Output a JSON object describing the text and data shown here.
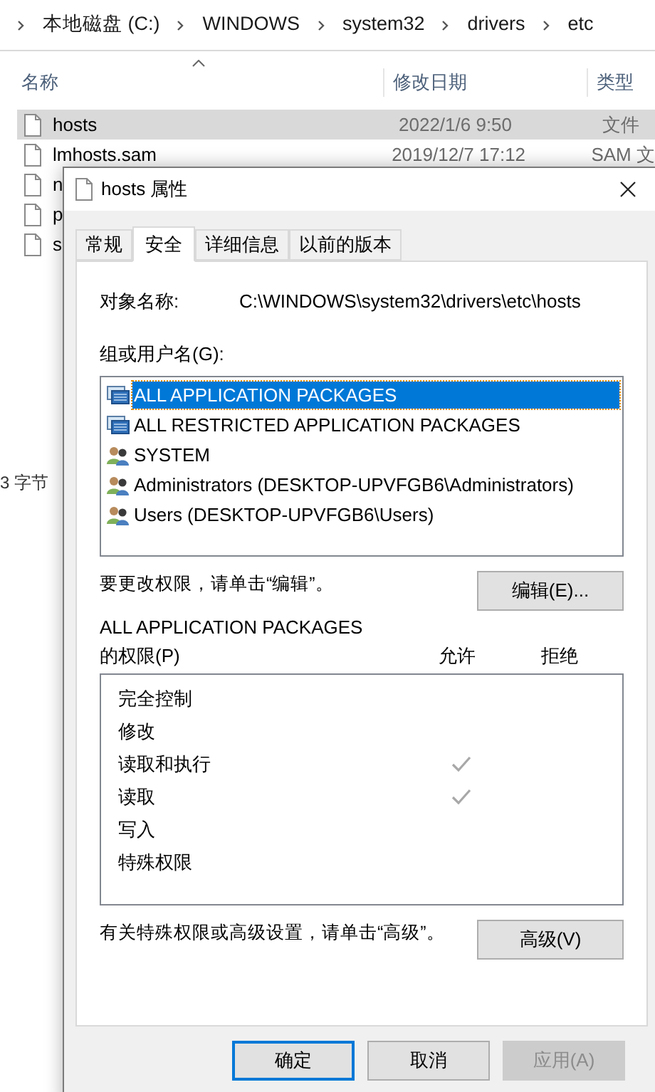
{
  "explorer": {
    "breadcrumb": [
      "本地磁盘 (C:)",
      "WINDOWS",
      "system32",
      "drivers",
      "etc"
    ],
    "columns": [
      "名称",
      "修改日期",
      "类型"
    ],
    "rows": [
      {
        "name": "hosts",
        "date": "2022/1/6 9:50",
        "type": "文件",
        "selected": true
      },
      {
        "name": "lmhosts.sam",
        "date": "2019/12/7 17:12",
        "type": "SAM 文",
        "selected": false
      },
      {
        "name": "n",
        "selected": false
      },
      {
        "name": "p",
        "selected": false
      },
      {
        "name": "s",
        "selected": false
      }
    ],
    "status_bar": "3 字节"
  },
  "dialog": {
    "title": "hosts 属性",
    "tabs": [
      {
        "label": "常规",
        "selected": false
      },
      {
        "label": "安全",
        "selected": true
      },
      {
        "label": "详细信息",
        "selected": false
      },
      {
        "label": "以前的版本",
        "selected": false
      }
    ],
    "object_label": "对象名称:",
    "object_value": "C:\\WINDOWS\\system32\\drivers\\etc\\hosts",
    "groups_label": "组或用户名(G):",
    "groups": [
      {
        "name": "ALL APPLICATION PACKAGES",
        "kind": "package",
        "selected": true
      },
      {
        "name": "ALL RESTRICTED APPLICATION PACKAGES",
        "kind": "package",
        "selected": false
      },
      {
        "name": "SYSTEM",
        "kind": "users",
        "selected": false
      },
      {
        "name": "Administrators (DESKTOP-UPVFGB6\\Administrators)",
        "kind": "users",
        "selected": false
      },
      {
        "name": "Users (DESKTOP-UPVFGB6\\Users)",
        "kind": "users",
        "selected": false
      }
    ],
    "edit_hint": "要更改权限，请单击“编辑”。",
    "edit_button": "编辑(E)...",
    "perm_for": "ALL APPLICATION PACKAGES",
    "perm_label": "的权限(P)",
    "allow_header": "允许",
    "deny_header": "拒绝",
    "permissions": [
      {
        "name": "完全控制",
        "allow": false,
        "deny": false
      },
      {
        "name": "修改",
        "allow": false,
        "deny": false
      },
      {
        "name": "读取和执行",
        "allow": true,
        "deny": false
      },
      {
        "name": "读取",
        "allow": true,
        "deny": false
      },
      {
        "name": "写入",
        "allow": false,
        "deny": false
      },
      {
        "name": "特殊权限",
        "allow": false,
        "deny": false
      }
    ],
    "advanced_hint": "有关特殊权限或高级设置，请单击“高级”。",
    "advanced_button": "高级(V)",
    "buttons": [
      {
        "label": "确定",
        "kind": "default"
      },
      {
        "label": "取消",
        "kind": "normal"
      },
      {
        "label": "应用(A)",
        "kind": "disabled"
      }
    ]
  }
}
